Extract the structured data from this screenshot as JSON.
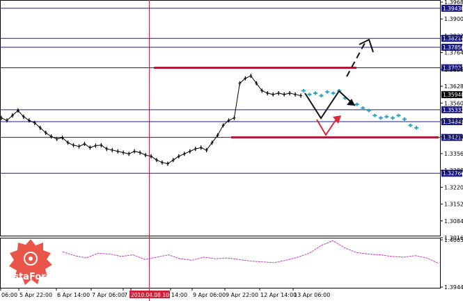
{
  "brand": {
    "name": "InstaForex",
    "accent": "#e8473a"
  },
  "colors": {
    "level_line": "#1a1a8c",
    "resistance": "#b3173a",
    "forecast": "#2aa6c0",
    "arrow": "#111111",
    "reversal": "#e0263a",
    "marker": "#d0213a",
    "indicator": "#c23fc4",
    "last_price_tag": "#000000",
    "level_tag": "#1a1a8c"
  },
  "chart_data": [
    {
      "type": "line",
      "title": "",
      "x_labels": [
        "06:00",
        "5 Apr 22:00",
        "6 Apr 14:00",
        "7 Apr 06:00",
        "7",
        "2010.04.08 10:00",
        "14:00",
        "9 Apr 06:00",
        "9 Apr 22:00",
        "12 Apr 14:00",
        "13 Apr 06:00"
      ],
      "y_ticks": [
        1.3968,
        1.39,
        1.3832,
        1.3764,
        1.3696,
        1.3628,
        1.356,
        1.3492,
        1.3424,
        1.3356,
        1.3288,
        1.322,
        1.3152,
        1.3084,
        1.3016
      ],
      "ylim": [
        1.3016,
        1.3968
      ],
      "levels": [
        1.3943,
        1.38214,
        1.37856,
        1.37027,
        1.35332,
        1.34849,
        1.34213,
        1.32766
      ],
      "last_price": 1.3594,
      "marker_date": "2010.04.08 10:00",
      "resistance_lines": [
        1.37027,
        1.34213
      ],
      "price_series": [
        1.35,
        1.349,
        1.351,
        1.353,
        1.3505,
        1.349,
        1.348,
        1.346,
        1.344,
        1.3425,
        1.3415,
        1.342,
        1.34,
        1.339,
        1.3385,
        1.3395,
        1.338,
        1.3388,
        1.339,
        1.3375,
        1.337,
        1.3365,
        1.336,
        1.3355,
        1.3365,
        1.336,
        1.335,
        1.3345,
        1.333,
        1.332,
        1.3315,
        1.333,
        1.3345,
        1.3355,
        1.3365,
        1.3375,
        1.338,
        1.337,
        1.34,
        1.343,
        1.347,
        1.349,
        1.35,
        1.364,
        1.366,
        1.367,
        1.364,
        1.361,
        1.36,
        1.3595,
        1.36,
        1.3595,
        1.36,
        1.3595,
        1.359
      ],
      "forecast_series": [
        1.361,
        1.3595,
        1.36,
        1.359,
        1.3605,
        1.36,
        1.361,
        1.358,
        1.356,
        1.3555,
        1.354,
        1.353,
        1.351,
        1.35,
        1.3505,
        1.35,
        1.351,
        1.3495,
        1.347,
        1.346
      ]
    },
    {
      "type": "line",
      "title": "",
      "y_ticks": [
        1.40052,
        1.39447
      ],
      "ylim": [
        1.39447,
        1.40052
      ],
      "series": [
        {
          "values": [
            1.399,
            1.3985,
            1.3982,
            1.3988,
            1.3987,
            1.3984,
            1.3986,
            1.398,
            1.3983,
            1.3986,
            1.3981,
            1.3979,
            1.3983,
            1.3981,
            1.3982,
            1.398,
            1.3978,
            1.3977,
            1.3976,
            1.3979,
            1.3983,
            1.3988,
            1.3998,
            1.4004,
            1.3995,
            1.3989,
            1.3987,
            1.3986,
            1.3984,
            1.3983,
            1.3985,
            1.3982,
            1.3975
          ]
        }
      ]
    }
  ]
}
